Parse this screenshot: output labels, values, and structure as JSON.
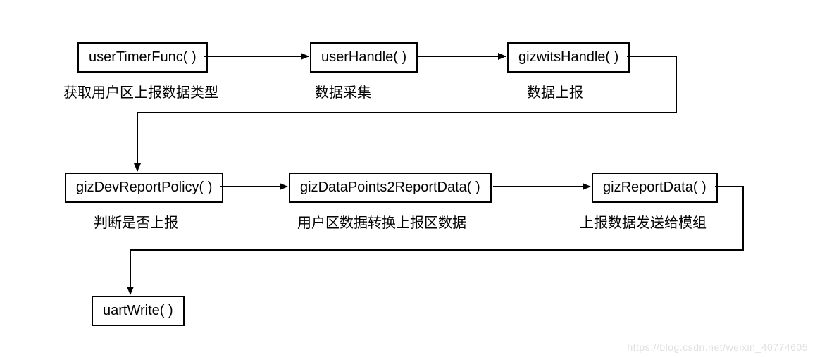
{
  "nodes": {
    "n1": {
      "label": "userTimerFunc( )",
      "caption": "获取用户区上报数据类型"
    },
    "n2": {
      "label": "userHandle( )",
      "caption": "数据采集"
    },
    "n3": {
      "label": "gizwitsHandle( )",
      "caption": "数据上报"
    },
    "n4": {
      "label": "gizDevReportPolicy( )",
      "caption": "判断是否上报"
    },
    "n5": {
      "label": "gizDataPoints2ReportData( )",
      "caption": "用户区数据转换上报区数据"
    },
    "n6": {
      "label": "gizReportData( )",
      "caption": "上报数据发送给模组"
    },
    "n7": {
      "label": "uartWrite( )"
    }
  },
  "watermark": "https://blog.csdn.net/weixin_40774605"
}
